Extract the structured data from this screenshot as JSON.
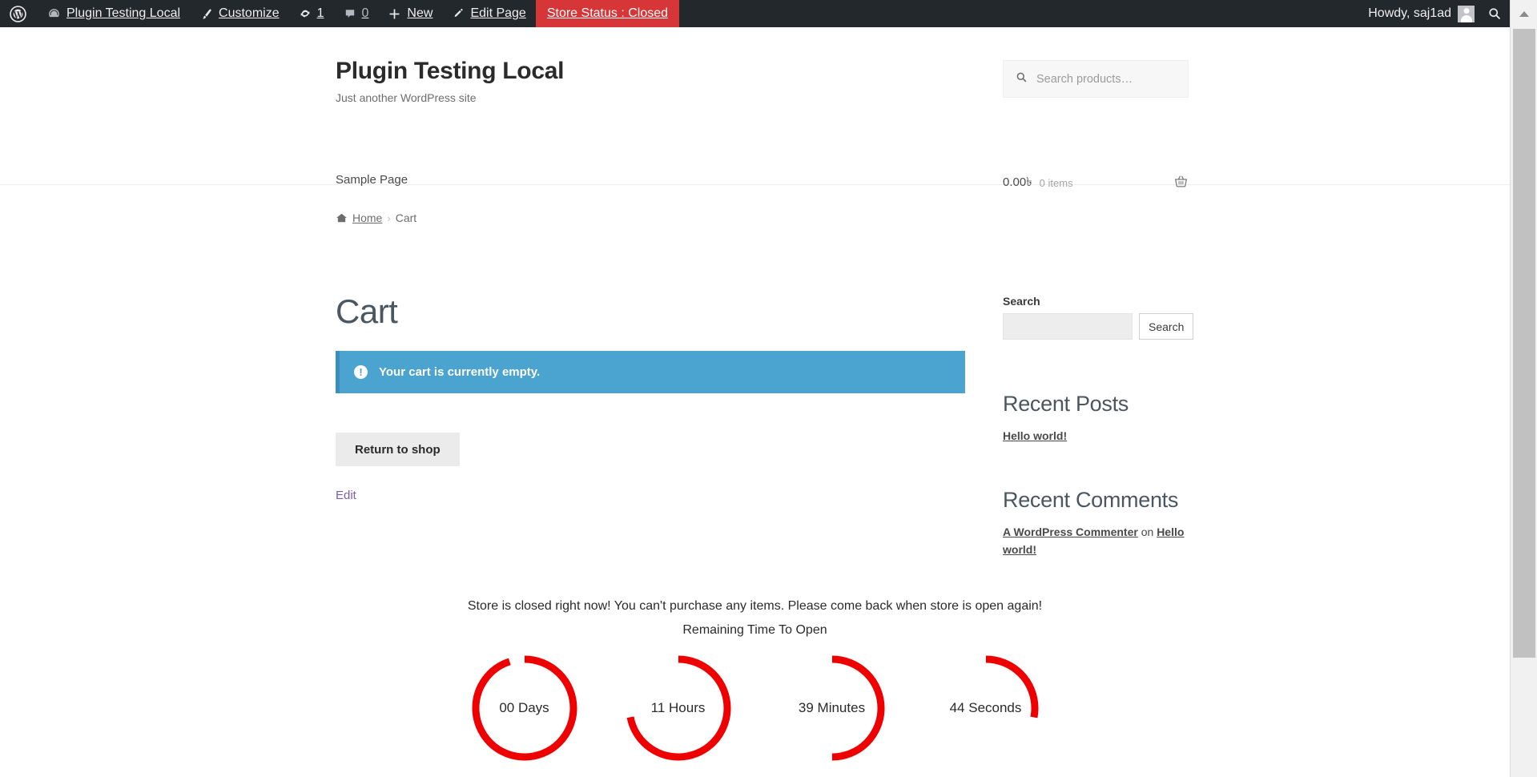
{
  "adminbar": {
    "wp_logo": "wordpress-logo-icon",
    "site_name": "Plugin Testing Local",
    "site_icon": "dashboard-icon",
    "customize": "Customize",
    "customize_icon": "paintbrush-icon",
    "updates_icon": "updates-icon",
    "updates_count": "1",
    "comments_icon": "comment-bubble-icon",
    "comments_count": "0",
    "new_icon": "plus-icon",
    "new": "New",
    "edit_page_icon": "pencil-icon",
    "edit_page": "Edit Page",
    "store_status": "Store Status : Closed",
    "store_status_color": "#d63638",
    "howdy": "Howdy, saj1ad",
    "avatar": "user-avatar",
    "search_icon": "search-icon"
  },
  "header": {
    "site_title": "Plugin Testing Local",
    "tagline": "Just another WordPress site",
    "product_search_placeholder": "Search products…",
    "product_search_value": "",
    "product_search_icon": "search-icon",
    "nav": [
      {
        "label": "Sample Page",
        "name": "nav-sample-page"
      }
    ],
    "cart": {
      "total": "0.00৳",
      "items": "0 items",
      "icon": "shopping-basket-icon"
    }
  },
  "breadcrumb": {
    "home_icon": "home-icon",
    "home": "Home",
    "separator": "›",
    "current": "Cart"
  },
  "main": {
    "page_title": "Cart",
    "notice": {
      "icon": "info-icon",
      "text": "Your cart is currently empty.",
      "background": "#4ba3cf"
    },
    "return_to_shop": "Return to shop",
    "edit_link": "Edit",
    "edit_link_color": "#7b5ea7"
  },
  "sidebar": {
    "search": {
      "label": "Search",
      "value": "",
      "button": "Search"
    },
    "recent_posts": {
      "title": "Recent Posts",
      "items": [
        "Hello world!"
      ]
    },
    "recent_comments": {
      "title": "Recent Comments",
      "items": [
        {
          "author": "A WordPress Commenter",
          "on": "on",
          "post": "Hello world!"
        }
      ]
    }
  },
  "store_closed": {
    "message": "Store is closed right now! You can't purchase any items. Please come back when store is open again!",
    "countdown_heading": "Remaining Time To Open",
    "ring_color": "#ee0000",
    "units": [
      {
        "label": "00 Days",
        "value": 0,
        "unit": "Days",
        "progress": 0.95
      },
      {
        "label": "11 Hours",
        "value": 11,
        "unit": "Hours",
        "progress": 0.72
      },
      {
        "label": "39 Minutes",
        "value": 39,
        "unit": "Minutes",
        "progress": 0.5
      },
      {
        "label": "44 Seconds",
        "value": 44,
        "unit": "Seconds",
        "progress": 0.28
      }
    ]
  },
  "scrollbar": {
    "up_arrow": "scroll-up-arrow"
  }
}
